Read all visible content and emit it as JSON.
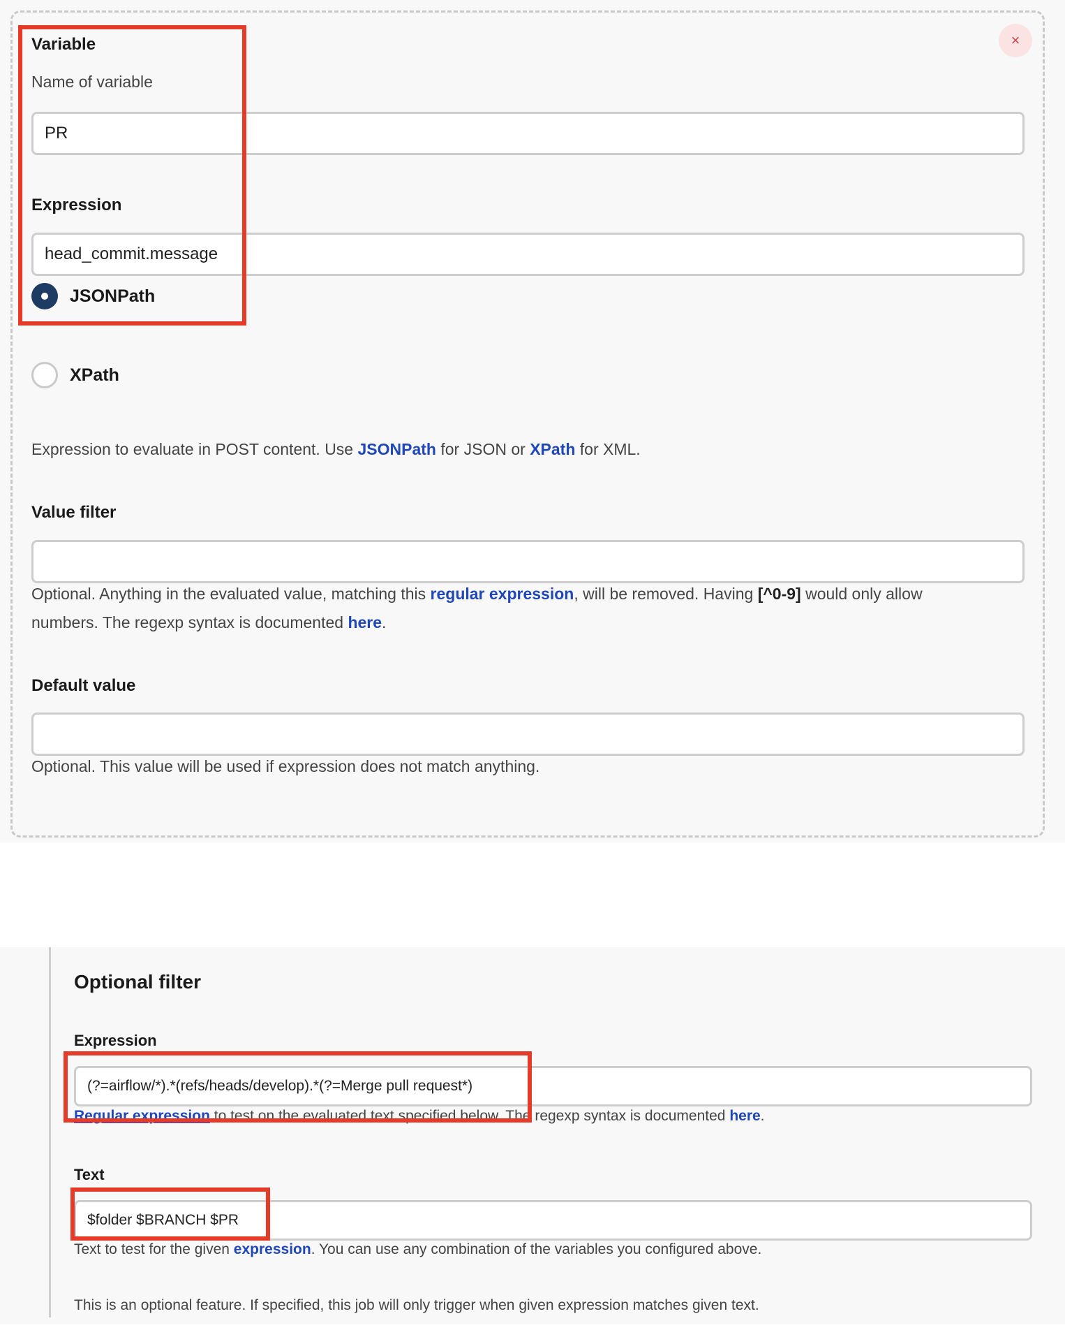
{
  "variable_section": {
    "heading": "Variable",
    "name_label": "Name of variable",
    "name_value": "PR",
    "expression_label": "Expression",
    "expression_value": "head_commit.message",
    "radio_jsonpath": "JSONPath",
    "radio_xpath": "XPath",
    "selected": "JSONPath",
    "expression_help": {
      "t1": "Expression to evaluate in POST content. Use ",
      "link1": "JSONPath",
      "t2": " for JSON or ",
      "link2": "XPath",
      "t3": " for XML."
    },
    "value_filter_label": "Value filter",
    "value_filter_value": "",
    "value_filter_help": {
      "t1": "Optional. Anything in the evaluated value, matching this ",
      "link1": "regular expression",
      "t2": ", will be removed. Having ",
      "code": "[^0-9]",
      "t3": " would only allow",
      "t4": "numbers. The regexp syntax is documented ",
      "link2": "here",
      "t5": "."
    },
    "default_value_label": "Default value",
    "default_value_value": "",
    "default_value_help": "Optional. This value will be used if expression does not match anything.",
    "close_icon": "×"
  },
  "optional_filter": {
    "heading": "Optional filter",
    "expression_label": "Expression",
    "expression_value": "(?=airflow/*).*(refs/heads/develop).*(?=Merge pull request*)",
    "expression_help": {
      "link1": "Regular expression",
      "t1": " to test on the evaluated text specified below. The regexp syntax is documented ",
      "link2": "here",
      "t2": "."
    },
    "text_label": "Text",
    "text_value": "$folder $BRANCH $PR",
    "text_help": {
      "t1": "Text to test for the given ",
      "link1": "expression",
      "t2": ". You can use any combination of the variables you configured above."
    },
    "note": "This is an optional feature. If specified, this job will only trigger when given expression matches given text."
  },
  "colors": {
    "highlight": "#e53c2a",
    "link": "#1f47b8",
    "radio_selected": "#1d3b63",
    "close": "#d0454c"
  }
}
